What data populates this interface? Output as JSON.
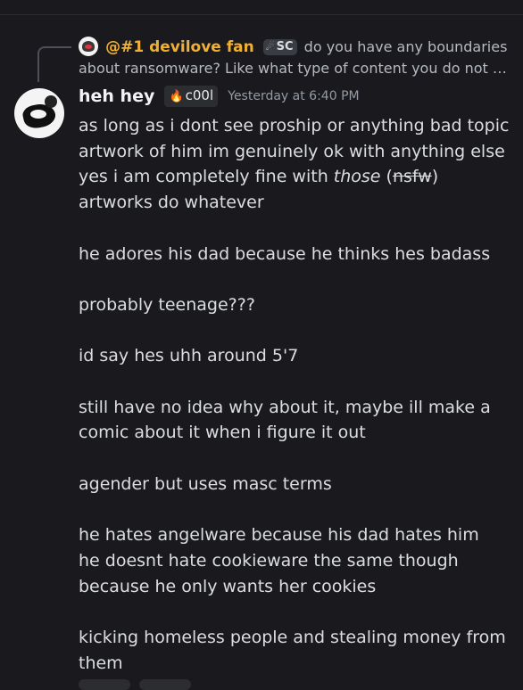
{
  "reply": {
    "author": "@#1 devilove fan",
    "tag": "SC",
    "text": "do you have any boundaries about ransomware? Like what type of content you do not …"
  },
  "message": {
    "username": "heh hey",
    "role_tag": "c00l",
    "timestamp": "Yesterday at 6:40 PM",
    "lines": {
      "l1": "as long as i dont see proship or anything bad topic artwork of him im genuinely ok with anything else",
      "l2_a": "yes i am completely fine with ",
      "l2_b": "those",
      "l2_c": " (",
      "l2_d": "nsfw",
      "l2_e": ") artworks do whatever",
      "l3": "he adores his dad because he thinks hes badass",
      "l4": "probably teenage???",
      "l5": "id say hes uhh around 5'7",
      "l6": "still have no idea why about it, maybe ill make a comic about it when i figure it out",
      "l7": "agender but uses masc terms",
      "l8_a": "he hates angelware because his dad hates him",
      "l8_b": "he doesnt hate cookieware the same though",
      "l8_c": "because he only wants her cookies",
      "l9": "kicking homeless people and stealing money from them"
    }
  },
  "icons": {
    "flame": "🔥",
    "reply_flame": "☄"
  },
  "colors": {
    "background": "#1a1a1e",
    "reply_author": "#f0b132",
    "text": "#dbdee1",
    "muted": "#949ba4"
  }
}
